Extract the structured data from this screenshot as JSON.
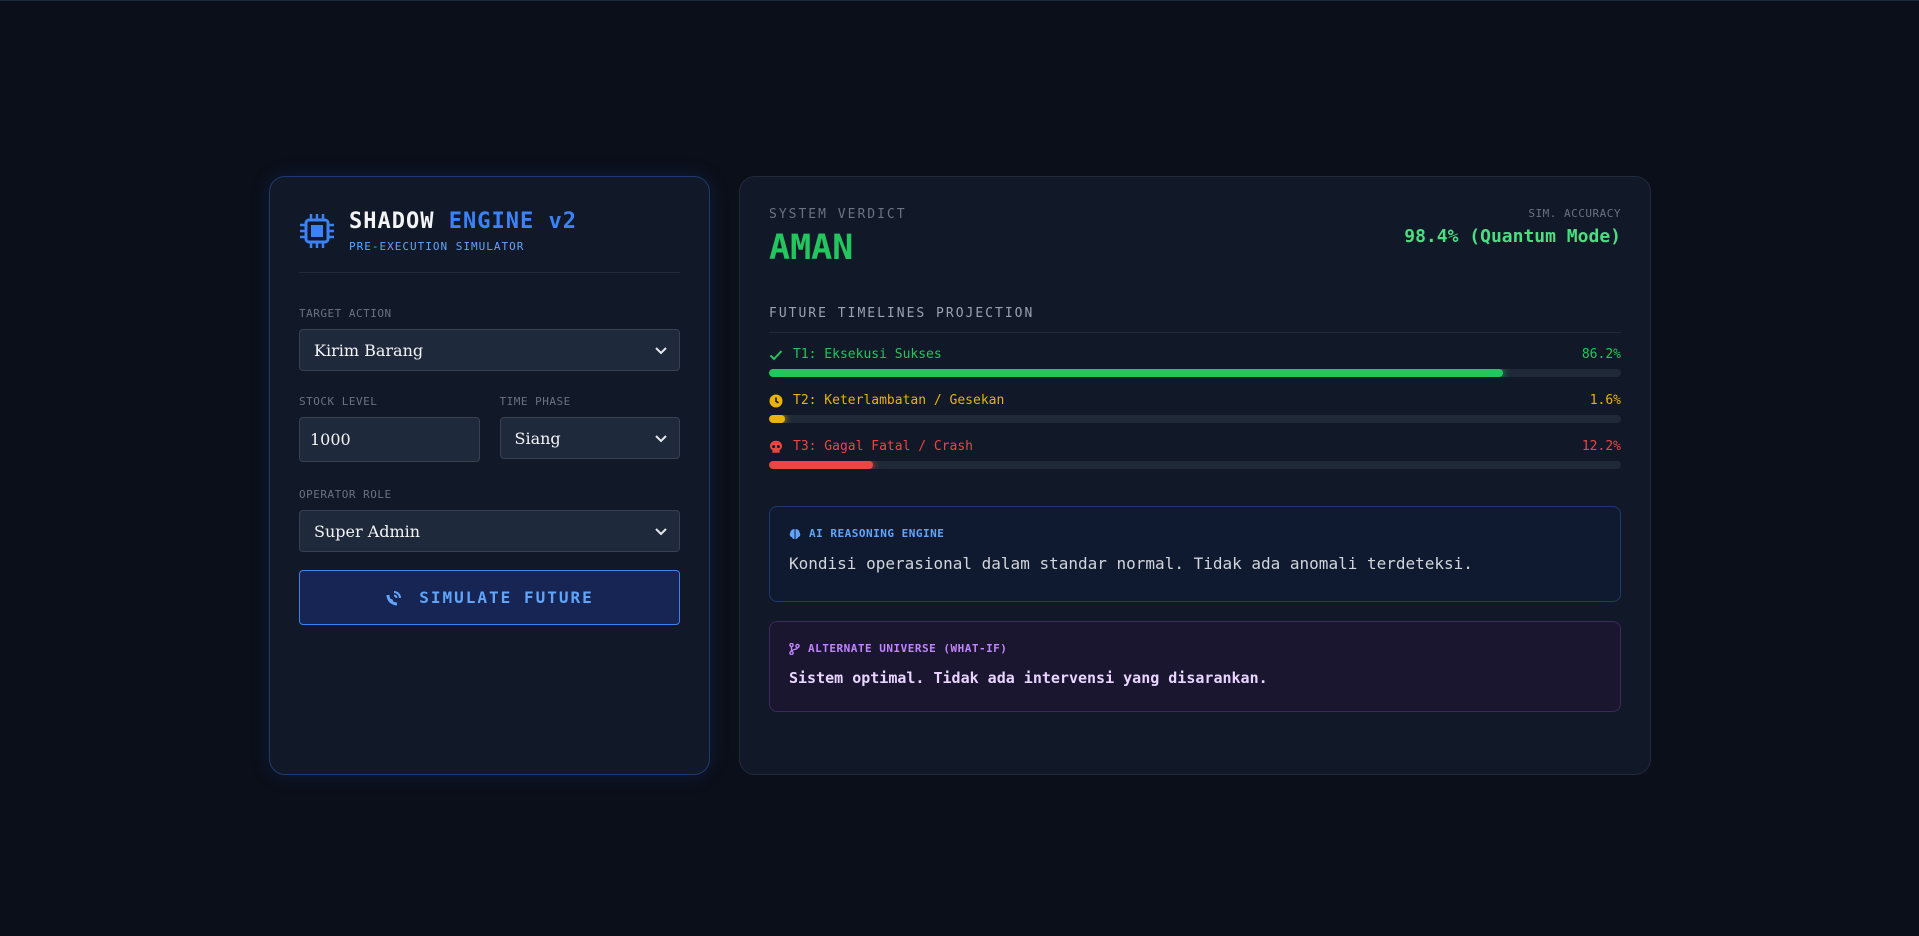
{
  "brand": {
    "title_part1": "SHADOW",
    "title_part2": "ENGINE v2",
    "subtitle": "PRE-EXECUTION SIMULATOR",
    "icon": "cpu-chip-icon"
  },
  "form": {
    "target_action": {
      "label": "TARGET ACTION",
      "value": "Kirim Barang"
    },
    "stock_level": {
      "label": "STOCK LEVEL",
      "value": "1000"
    },
    "time_phase": {
      "label": "TIME PHASE",
      "value": "Siang"
    },
    "operator_role": {
      "label": "OPERATOR ROLE",
      "value": "Super Admin"
    },
    "simulate_button": {
      "label": "SIMULATE FUTURE",
      "icon": "satellite-dish-icon"
    }
  },
  "verdict": {
    "label": "SYSTEM VERDICT",
    "value": "AMAN",
    "accuracy_label": "SIM. ACCURACY",
    "accuracy_value": "98.4% (Quantum Mode)"
  },
  "timelines": {
    "title": "FUTURE TIMELINES PROJECTION",
    "items": [
      {
        "name": "T1: Eksekusi Sukses",
        "percent_label": "86.2%",
        "fraction": 0.862,
        "color": "#22c55e",
        "icon": "check-icon"
      },
      {
        "name": "T2: Keterlambatan / Gesekan",
        "percent_label": "1.6%",
        "fraction": 0.016,
        "color": "#eab308",
        "icon": "clock-icon"
      },
      {
        "name": "T3: Gagal Fatal / Crash",
        "percent_label": "12.2%",
        "fraction": 0.122,
        "color": "#ef4444",
        "icon": "skull-icon"
      }
    ]
  },
  "ai_reasoning": {
    "title": "AI REASONING ENGINE",
    "icon": "brain-icon",
    "text": "Kondisi operasional dalam standar normal. Tidak ada anomali terdeteksi."
  },
  "alternate_universe": {
    "title": "ALTERNATE UNIVERSE (WHAT-IF)",
    "icon": "code-branch-icon",
    "text": "Sistem optimal. Tidak ada intervensi yang disarankan."
  },
  "colors": {
    "accent_blue": "#3b82f6",
    "success": "#22c55e",
    "warning": "#eab308",
    "danger": "#ef4444",
    "whatif_purple": "#c084fc"
  }
}
